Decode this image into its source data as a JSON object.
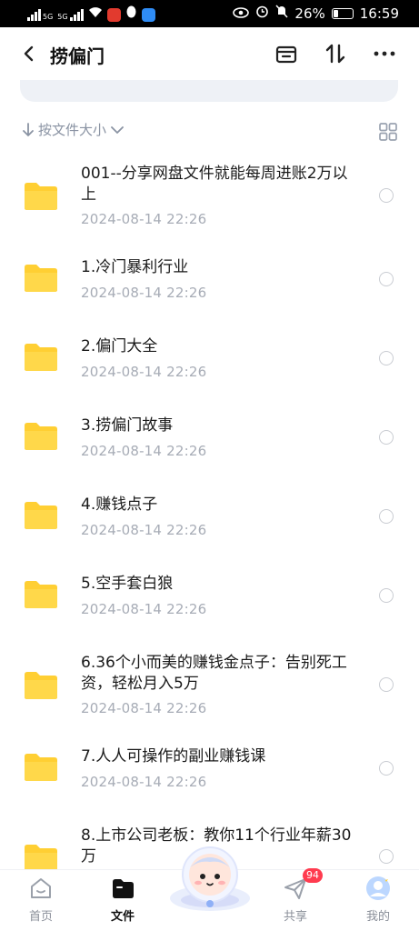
{
  "status_bar": {
    "battery": "26%",
    "time": "16:59",
    "net_left": "5G",
    "net_right": "5G"
  },
  "header": {
    "title": "捞偏门"
  },
  "sort": {
    "label": "按文件大小"
  },
  "files": [
    {
      "name": "001--分享网盘文件就能每周进账2万以上",
      "date": "2024-08-14  22:26"
    },
    {
      "name": "1.冷门暴利行业",
      "date": "2024-08-14  22:26"
    },
    {
      "name": "2.偏门大全",
      "date": "2024-08-14  22:26"
    },
    {
      "name": "3.捞偏门故事",
      "date": "2024-08-14  22:26"
    },
    {
      "name": "4.赚钱点子",
      "date": "2024-08-14  22:26"
    },
    {
      "name": "5.空手套白狼",
      "date": "2024-08-14  22:26"
    },
    {
      "name": "6.36个小而美的赚钱金点子：告别死工资，轻松月入5万",
      "date": "2024-08-14  22:26"
    },
    {
      "name": "7.人人可操作的副业赚钱课",
      "date": "2024-08-14  22:26"
    },
    {
      "name": "8.上市公司老板：教你11个行业年薪30万",
      "date": ""
    }
  ],
  "bottom_nav": {
    "home": "首页",
    "files": "文件",
    "share": "共享",
    "mine": "我的",
    "share_badge": "94"
  },
  "colors": {
    "folder": "#ffcf33",
    "accent_badge": "#ff3b4f",
    "muted": "#a7acb6"
  }
}
